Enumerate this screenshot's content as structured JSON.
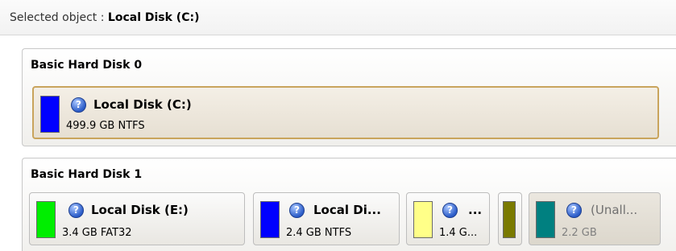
{
  "header": {
    "label": "Selected object : ",
    "value": "Local Disk (C:)"
  },
  "disks": [
    {
      "title": "Basic Hard Disk 0",
      "partitions": [
        {
          "name": "Local Disk (C:)",
          "size": "499.9 GB NTFS",
          "color": "#0000ff",
          "selected": true,
          "icon": "question-icon"
        }
      ]
    },
    {
      "title": "Basic Hard Disk 1",
      "partitions": [
        {
          "name": "Local Disk (E:)",
          "size": "3.4 GB FAT32",
          "color": "#00ee00",
          "selected": false,
          "icon": "question-icon"
        },
        {
          "name": "Local Di...",
          "size": "2.4 GB NTFS",
          "color": "#0000ff",
          "selected": false,
          "icon": "question-icon"
        },
        {
          "name": "...",
          "size": "1.4 G...",
          "color": "#ffff88",
          "selected": false,
          "icon": "question-icon"
        },
        {
          "name": "",
          "size": "",
          "color": "#7a7a00",
          "selected": false
        },
        {
          "name": "(Unall...",
          "size": "2.2 GB",
          "color": "#008080",
          "selected": false,
          "icon": "question-icon"
        }
      ]
    }
  ]
}
